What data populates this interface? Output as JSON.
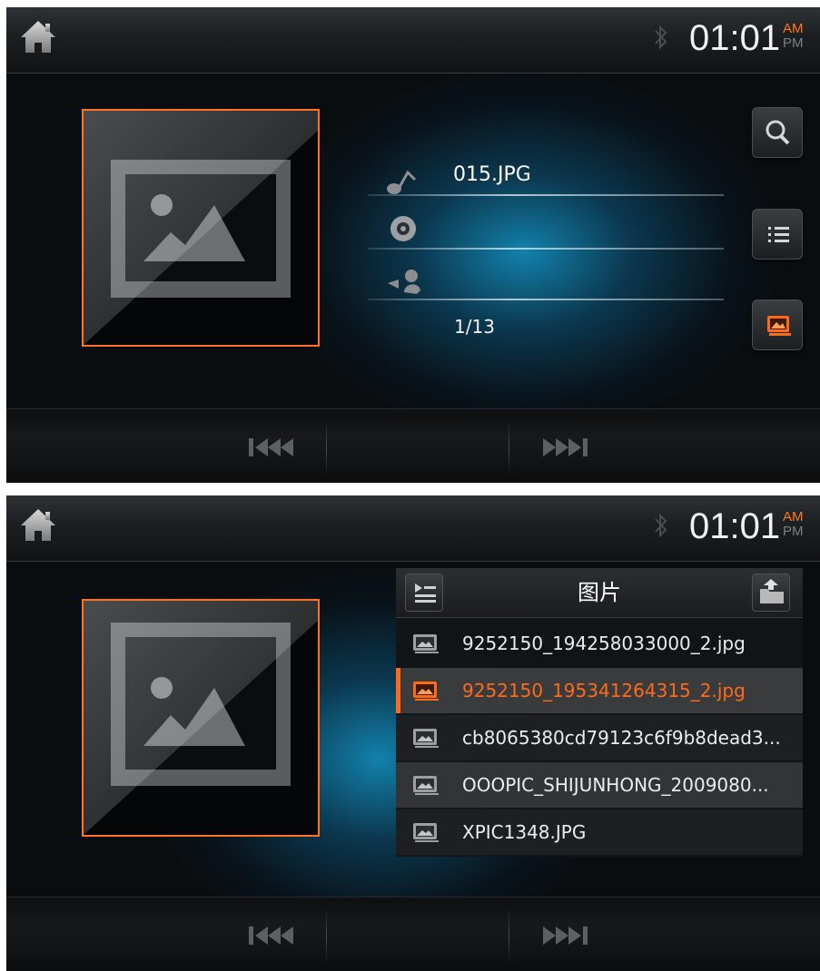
{
  "status": {
    "time": "01:01",
    "am": "AM",
    "pm": "PM",
    "bluetooth_icon": "bluetooth-icon",
    "home_icon": "home-icon"
  },
  "colors": {
    "accent": "#ff7424",
    "glow": "#1496c8",
    "background": "#0a0d10"
  },
  "screen1": {
    "track_title": "015.JPG",
    "album": "",
    "artist": "",
    "counter": "1/13",
    "side_buttons": [
      "search-icon",
      "playlist-icon",
      "photo-icon"
    ]
  },
  "screen2": {
    "list": {
      "title": "图片",
      "items": [
        {
          "label": "9252150_194258033000_2.jpg",
          "selected": false
        },
        {
          "label": "9252150_195341264315_2.jpg",
          "selected": true
        },
        {
          "label": "cb8065380cd79123c6f9b8dead3...",
          "selected": false
        },
        {
          "label": "OOOPIC_SHIJUNHONG_2009080...",
          "selected": false
        },
        {
          "label": "XPIC1348.JPG",
          "selected": false
        }
      ]
    }
  },
  "controls": {
    "prev_icon": "previous-track-icon",
    "next_icon": "next-track-icon"
  }
}
